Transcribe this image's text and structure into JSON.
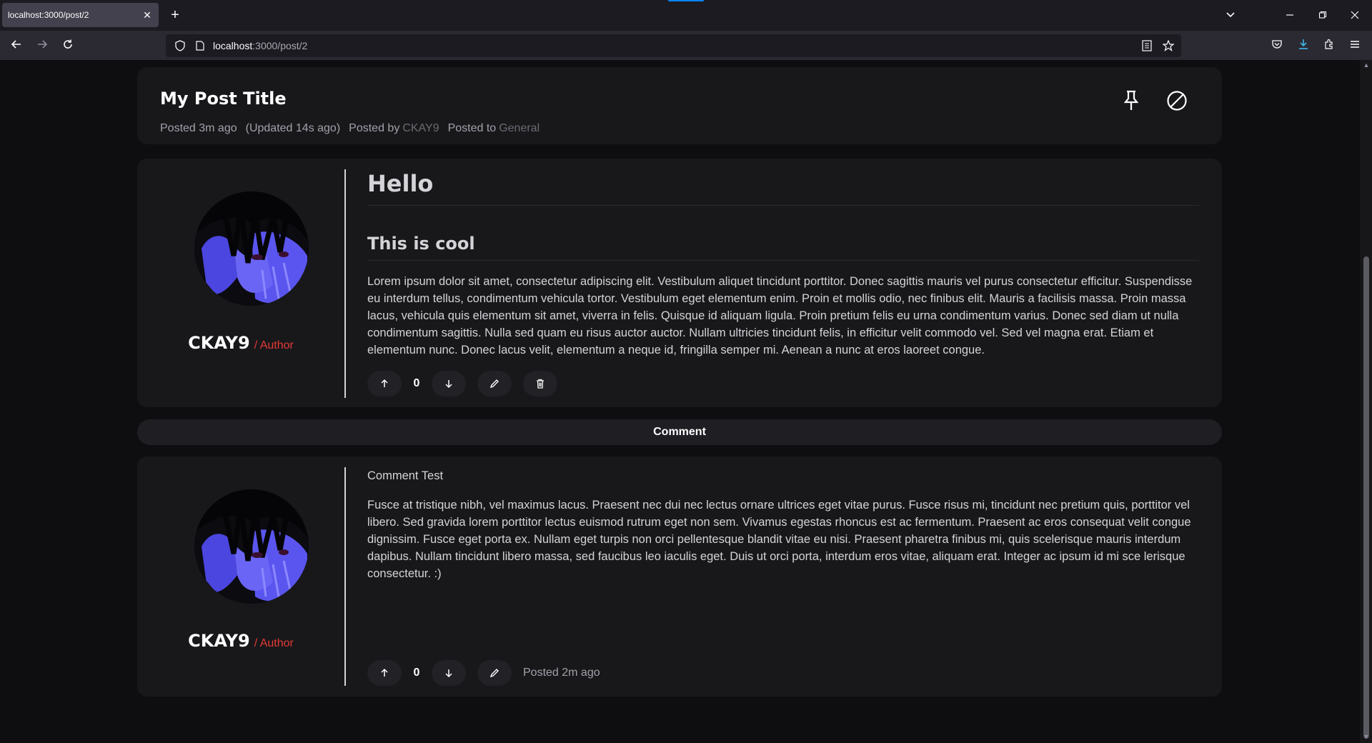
{
  "browser": {
    "tab_title": "localhost:3000/post/2",
    "url_host": "localhost",
    "url_path": ":3000/post/2"
  },
  "post": {
    "title": "My Post Title",
    "posted": "Posted 3m ago",
    "updated": "(Updated 14s ago)",
    "posted_by_label": "Posted by",
    "author": "CKAY9",
    "posted_to_label": "Posted to",
    "category": "General",
    "heading1": "Hello",
    "heading2": "This is cool",
    "body": "Lorem ipsum dolor sit amet, consectetur adipiscing elit. Vestibulum aliquet tincidunt porttitor. Donec sagittis mauris vel purus consectetur efficitur. Suspendisse eu interdum tellus, condimentum vehicula tortor. Vestibulum eget elementum enim. Proin et mollis odio, nec finibus elit. Mauris a facilisis massa. Proin massa lacus, vehicula quis elementum sit amet, viverra in felis. Quisque id aliquam ligula. Proin pretium felis eu urna condimentum varius. Donec sed diam ut nulla condimentum sagittis. Nulla sed quam eu risus auctor auctor. Nullam ultricies tincidunt felis, in efficitur velit commodo vel. Sed vel magna erat. Etiam et elementum nunc. Donec lacus velit, elementum a neque id, fringilla semper mi. Aenean a nunc at eros laoreet congue.",
    "votes": "0",
    "author_name": "CKAY9",
    "author_role": "/ Author"
  },
  "comment_button": "Comment",
  "comment": {
    "title": "Comment Test",
    "body": "Fusce at tristique nibh, vel maximus lacus. Praesent nec dui nec lectus ornare ultrices eget vitae purus. Fusce risus mi, tincidunt nec pretium quis, porttitor vel libero. Sed gravida lorem porttitor lectus euismod rutrum eget non sem. Vivamus egestas rhoncus est ac fermentum. Praesent ac eros consequat velit congue dignissim. Fusce eget porta ex. Nullam eget turpis non orci pellentesque blandit vitae eu nisi. Praesent pharetra finibus mi, quis scelerisque mauris interdum dapibus. Nullam tincidunt libero massa, sed faucibus leo iaculis eget. Duis ut orci porta, interdum eros vitae, aliquam erat. Integer ac ipsum id mi sce lerisque consectetur. :)",
    "votes": "0",
    "posted": "Posted 2m ago",
    "author_name": "CKAY9",
    "author_role": "/ Author"
  },
  "colors": {
    "background": "#0e0e10",
    "card": "#18181b",
    "author_role": "#e53935",
    "link_muted": "#6b6b73"
  }
}
